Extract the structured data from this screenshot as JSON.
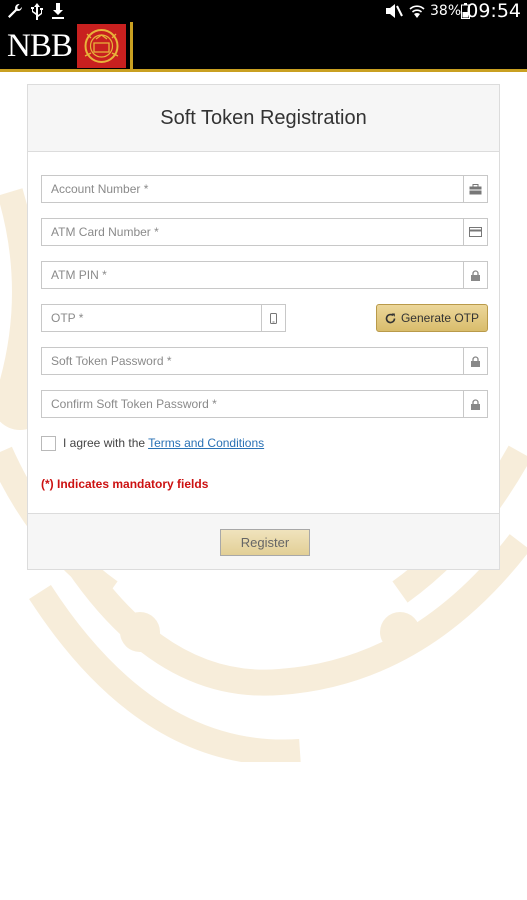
{
  "status_bar": {
    "battery_percent": "38%",
    "time": "09:54",
    "left_icons": [
      "wrench-icon",
      "usb-icon",
      "download-icon"
    ],
    "right_icons": [
      "mute-icon",
      "wifi-icon",
      "battery-icon"
    ]
  },
  "header": {
    "logo_text": "NBB",
    "brand_colors": {
      "black": "#000000",
      "gold": "#c9a021",
      "red": "#c8201f"
    }
  },
  "form": {
    "title": "Soft Token Registration",
    "fields": {
      "account_number": {
        "placeholder": "Account Number *",
        "value": "",
        "icon": "briefcase-icon"
      },
      "atm_card_number": {
        "placeholder": "ATM Card Number *",
        "value": "",
        "icon": "credit-card-icon"
      },
      "atm_pin": {
        "placeholder": "ATM PIN *",
        "value": "",
        "icon": "lock-icon"
      },
      "otp": {
        "placeholder": "OTP *",
        "value": "",
        "icon": "mobile-icon"
      },
      "soft_token_password": {
        "placeholder": "Soft Token Password *",
        "value": "",
        "icon": "lock-icon"
      },
      "confirm_soft_token_password": {
        "placeholder": "Confirm Soft Token Password *",
        "value": "",
        "icon": "lock-icon"
      }
    },
    "generate_otp_label": "Generate OTP",
    "agree_text": "I agree with the",
    "terms_link": "Terms and Conditions",
    "agree_checked": false,
    "mandatory_note": "(*) Indicates mandatory fields",
    "register_label": "Register"
  }
}
